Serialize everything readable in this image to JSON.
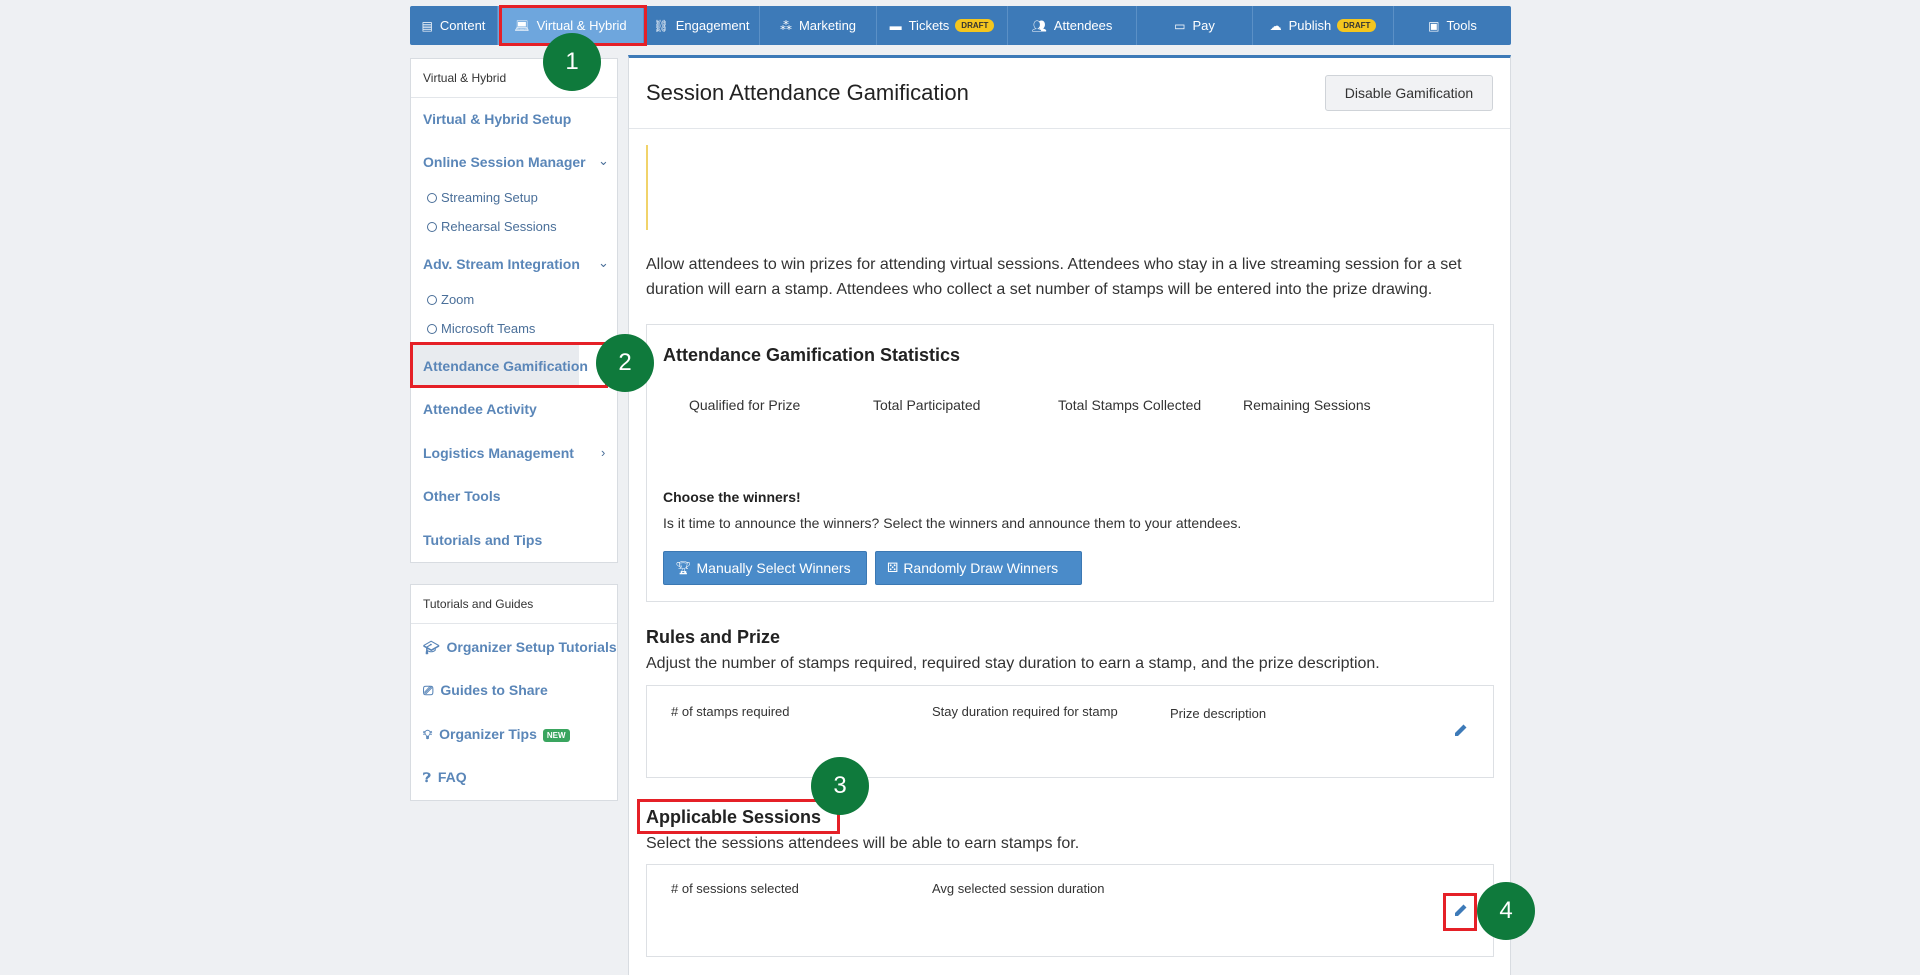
{
  "topnav": {
    "tabs": [
      {
        "label": "Content",
        "icon": "newspaper-icon",
        "badge": ""
      },
      {
        "label": "Virtual & Hybrid",
        "icon": "laptop-icon",
        "badge": ""
      },
      {
        "label": "Engagement",
        "icon": "network-icon",
        "badge": ""
      },
      {
        "label": "Marketing",
        "icon": "people-group-icon",
        "badge": ""
      },
      {
        "label": "Tickets",
        "icon": "ticket-icon",
        "badge": "DRAFT"
      },
      {
        "label": "Attendees",
        "icon": "users-icon",
        "badge": ""
      },
      {
        "label": "Pay",
        "icon": "credit-card-icon",
        "badge": ""
      },
      {
        "label": "Publish",
        "icon": "cloud-upload-icon",
        "badge": "DRAFT"
      },
      {
        "label": "Tools",
        "icon": "toolbox-icon",
        "badge": ""
      }
    ],
    "active_tab": "Virtual & Hybrid"
  },
  "sidebar": {
    "header": "Virtual & Hybrid",
    "items": {
      "setup": "Virtual & Hybrid Setup",
      "osm": "Online Session Manager",
      "streaming": "Streaming Setup",
      "rehearsal": "Rehearsal Sessions",
      "adv": "Adv. Stream Integration",
      "zoom": "Zoom",
      "teams": "Microsoft Teams",
      "gamification": "Attendance Gamification",
      "activity": "Attendee Activity",
      "logistics": "Logistics Management",
      "other": "Other Tools",
      "tutorials": "Tutorials and Tips"
    },
    "active_item": "Attendance Gamification"
  },
  "guides": {
    "header": "Tutorials and Guides",
    "organizer_setup": "Organizer Setup Tutorials",
    "guides_share": "Guides to Share",
    "organizer_tips": "Organizer Tips",
    "tips_badge": "NEW",
    "faq": "FAQ"
  },
  "main": {
    "title": "Session Attendance Gamification",
    "disable_button": "Disable Gamification",
    "intro": "Allow attendees to win prizes for attending virtual sessions. Attendees who stay in a live streaming session for a set duration will earn a stamp. Attendees who collect a set number of stamps will be entered into the prize drawing.",
    "stats": {
      "title": "Attendance Gamification Statistics",
      "qualified": "Qualified for Prize",
      "participated": "Total Participated",
      "stamps": "Total Stamps Collected",
      "remaining": "Remaining Sessions",
      "choose_title": "Choose the winners!",
      "choose_desc": "Is it time to announce the winners? Select the winners and announce them to your attendees.",
      "manual_btn": "Manually Select Winners",
      "random_btn": "Randomly Draw Winners"
    },
    "rules": {
      "title": "Rules and Prize",
      "desc": "Adjust the number of stamps required, required stay duration to earn a stamp, and the prize description.",
      "col_stamps": "# of stamps required",
      "col_duration": "Stay duration required for stamp",
      "col_prize": "Prize description"
    },
    "sessions": {
      "title": "Applicable Sessions",
      "desc": "Select the sessions attendees will be able to earn stamps for.",
      "col_selected": "# of sessions selected",
      "col_avg": "Avg selected session duration"
    }
  },
  "annotations": {
    "step1": "1",
    "step2": "2",
    "step3": "3",
    "step4": "4",
    "highlight_color": "#e52027",
    "step_color": "#0f7a3c"
  }
}
